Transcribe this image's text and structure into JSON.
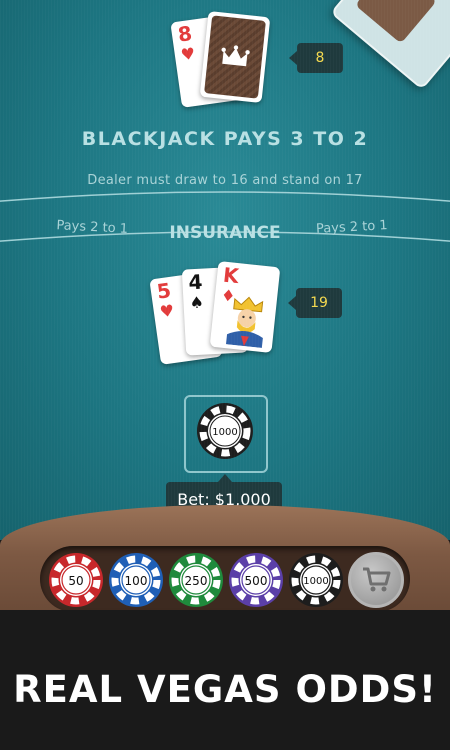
{
  "dealer": {
    "cards": [
      {
        "rank": "8",
        "suit": "♥",
        "color": "red"
      }
    ],
    "score": "8"
  },
  "table": {
    "title": "BLACKJACK PAYS 3 TO 2",
    "rule": "Dealer must draw to 16 and stand on 17",
    "insurance_left": "Pays 2 to 1",
    "insurance_center": "INSURANCE",
    "insurance_right": "Pays 2 to 1"
  },
  "player": {
    "cards": [
      {
        "rank": "5",
        "suit": "♥",
        "color": "red"
      },
      {
        "rank": "4",
        "suit": "♠",
        "color": "black"
      },
      {
        "rank": "K",
        "suit": "♦",
        "color": "red"
      }
    ],
    "score": "19"
  },
  "bet": {
    "chip_value": "1000",
    "label": "Bet: $1,000"
  },
  "chips": [
    {
      "value": "50",
      "color": "#c8282b"
    },
    {
      "value": "100",
      "color": "#1f5fb6"
    },
    {
      "value": "250",
      "color": "#1f8a3c"
    },
    {
      "value": "500",
      "color": "#5b3fa8"
    },
    {
      "value": "1000",
      "color": "#1d1d1d"
    }
  ],
  "shop": {
    "icon": "cart-icon"
  },
  "banner": {
    "text": "REAL VEGAS ODDS!"
  }
}
